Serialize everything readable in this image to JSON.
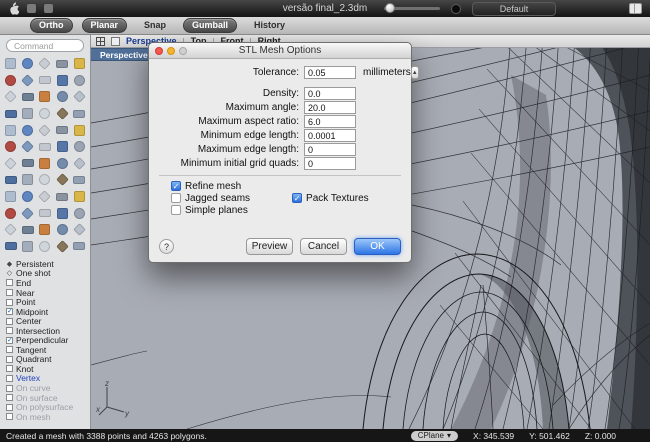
{
  "window": {
    "title": "versão final_2.3dm",
    "workspace_dropdown": "Default"
  },
  "toolbar": {
    "buttons": [
      {
        "label": "Ortho",
        "active": true
      },
      {
        "label": "Planar",
        "active": true
      },
      {
        "label": "Snap",
        "active": false
      },
      {
        "label": "Gumball",
        "active": true
      },
      {
        "label": "History",
        "active": false
      }
    ]
  },
  "sidebar": {
    "command_placeholder": "Command",
    "tool_palette": [
      "#aebccf",
      "#5f86c0",
      "#c9cdd3",
      "#8a93a0",
      "#d9b648",
      "#b24a44",
      "#7d99bd",
      "#c2c7cf",
      "#5776a8",
      "#9aa4b2",
      "#ccd2da",
      "#6f7f94",
      "#c97f3f",
      "#748cab",
      "#b8c0cb",
      "#4f6f9f",
      "#a3adbb",
      "#d0d5dc",
      "#87765a",
      "#93a0b3"
    ],
    "osnap_items": [
      {
        "label": "Persistent",
        "kind": "diamond-solid"
      },
      {
        "label": "One shot",
        "kind": "diamond-outline"
      },
      {
        "label": "End",
        "kind": "checkbox",
        "checked": false
      },
      {
        "label": "Near",
        "kind": "checkbox",
        "checked": false
      },
      {
        "label": "Point",
        "kind": "checkbox",
        "checked": false
      },
      {
        "label": "Midpoint",
        "kind": "checkbox",
        "checked": true
      },
      {
        "label": "Center",
        "kind": "checkbox",
        "checked": false
      },
      {
        "label": "Intersection",
        "kind": "checkbox",
        "checked": false
      },
      {
        "label": "Perpendicular",
        "kind": "checkbox",
        "checked": true
      },
      {
        "label": "Tangent",
        "kind": "checkbox",
        "checked": false
      },
      {
        "label": "Quadrant",
        "kind": "checkbox",
        "checked": false
      },
      {
        "label": "Knot",
        "kind": "checkbox",
        "checked": false
      },
      {
        "label": "Vertex",
        "kind": "checkbox",
        "checked": false,
        "accent": true
      },
      {
        "label": "On curve",
        "kind": "checkbox",
        "checked": false,
        "disabled": true
      },
      {
        "label": "On surface",
        "kind": "checkbox",
        "checked": false,
        "disabled": true
      },
      {
        "label": "On polysurface",
        "kind": "checkbox",
        "checked": false,
        "disabled": true
      },
      {
        "label": "On mesh",
        "kind": "checkbox",
        "checked": false,
        "disabled": true
      }
    ]
  },
  "viewport": {
    "tabs": [
      {
        "label": "Perspective",
        "active": true
      },
      {
        "label": "Top",
        "active": false
      },
      {
        "label": "Front",
        "active": false
      },
      {
        "label": "Right",
        "active": false
      }
    ],
    "active_label": "Perspective",
    "axis_labels": {
      "x": "x",
      "y": "y",
      "z": "z"
    }
  },
  "dialog": {
    "title": "STL Mesh Options",
    "tolerance": {
      "label": "Tolerance:",
      "value": "0.05",
      "unit": "millimeters"
    },
    "fields": [
      {
        "label": "Density:",
        "value": "0.0"
      },
      {
        "label": "Maximum angle:",
        "value": "20.0"
      },
      {
        "label": "Maximum aspect ratio:",
        "value": "6.0"
      },
      {
        "label": "Minimum edge length:",
        "value": "0.0001"
      },
      {
        "label": "Maximum edge length:",
        "value": "0"
      },
      {
        "label": "Minimum initial grid quads:",
        "value": "0"
      }
    ],
    "checkboxes_left": [
      {
        "label": "Refine mesh",
        "checked": true
      },
      {
        "label": "Jagged seams",
        "checked": false
      },
      {
        "label": "Simple planes",
        "checked": false
      }
    ],
    "checkboxes_right": [
      {
        "label": "Pack Textures",
        "checked": true
      }
    ],
    "help_label": "?",
    "buttons": [
      {
        "label": "Preview",
        "default": false
      },
      {
        "label": "Cancel",
        "default": false
      },
      {
        "label": "OK",
        "default": true
      }
    ]
  },
  "statusbar": {
    "message": "Created a mesh with 3388 points and 4263 polygons.",
    "cplane_label": "CPlane",
    "coords": [
      {
        "label": "X:",
        "value": "345.539"
      },
      {
        "label": "Y:",
        "value": "501.462"
      },
      {
        "label": "Z:",
        "value": "0.000"
      }
    ]
  },
  "icons": {
    "disclosure": "▲",
    "dropdown_arrow": "▾",
    "check": "✓",
    "diamond_solid": "◆",
    "diamond_outline": "◇"
  },
  "colors": {
    "ok_button": "#2e75e6",
    "viewport_bg": "#a8acb4",
    "active_tab_text": "#15398f",
    "viewport_badge_bg": "#50709a",
    "checkbox_checked": "#2e6fd8"
  }
}
